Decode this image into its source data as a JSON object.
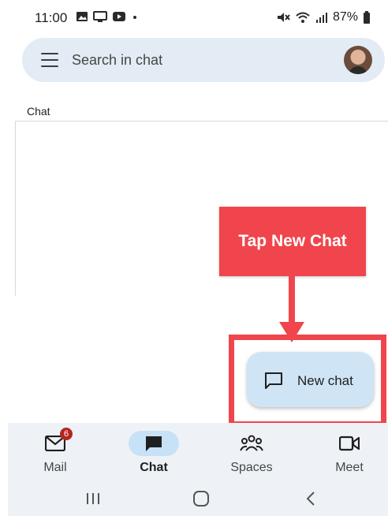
{
  "status_bar": {
    "time": "11:00",
    "battery": "87%",
    "icons_left": [
      "image-icon",
      "cast-icon",
      "youtube-icon",
      "dot-icon"
    ],
    "icons_right": [
      "mute-icon",
      "wifi-icon",
      "signal-icon",
      "battery-icon"
    ]
  },
  "search": {
    "placeholder": "Search in chat"
  },
  "section": {
    "chat_label": "Chat"
  },
  "annotation": {
    "callout_text": "Tap New Chat",
    "color": "#f0454c"
  },
  "fab": {
    "label": "New chat"
  },
  "bottom_nav": {
    "items": [
      {
        "label": "Mail",
        "icon": "mail-icon",
        "badge": "6"
      },
      {
        "label": "Chat",
        "icon": "chat-icon",
        "active": true
      },
      {
        "label": "Spaces",
        "icon": "spaces-icon"
      },
      {
        "label": "Meet",
        "icon": "video-icon"
      }
    ]
  },
  "system_nav": [
    "recent-apps-icon",
    "home-icon",
    "back-icon"
  ]
}
